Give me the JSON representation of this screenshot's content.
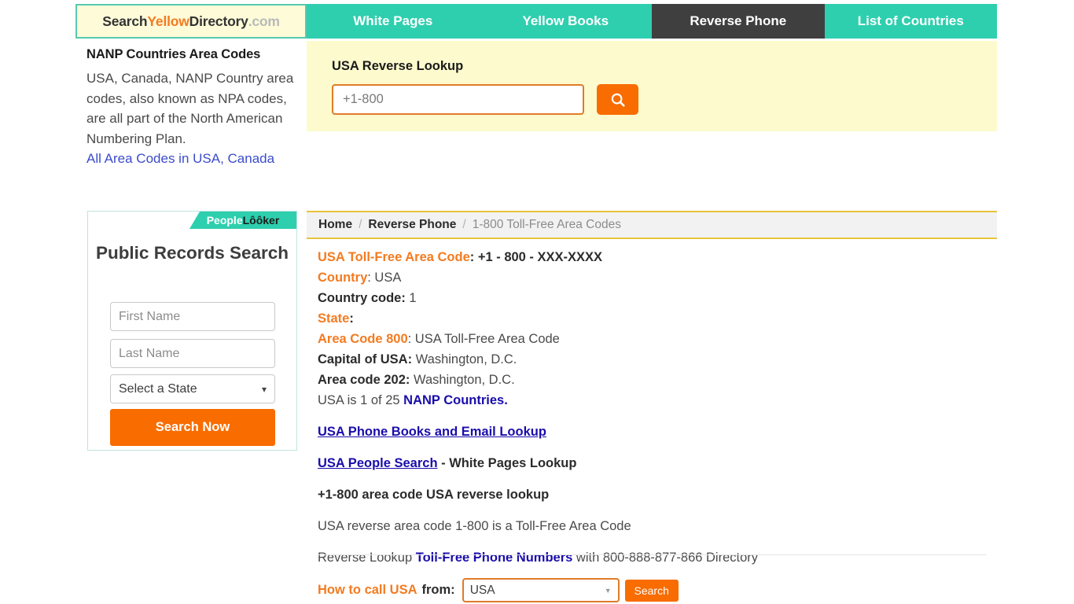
{
  "header": {
    "logo": {
      "search": "Search",
      "yellow": "Yellow",
      "directory": "Directory",
      "com": ".com"
    },
    "nav": [
      {
        "label": "White Pages",
        "active": false
      },
      {
        "label": "Yellow Books",
        "active": false
      },
      {
        "label": "Reverse Phone",
        "active": true
      },
      {
        "label": "List of Countries",
        "active": false
      }
    ]
  },
  "sidebar": {
    "title": "NANP Countries Area Codes",
    "body": "USA, Canada, NANP Country area codes, also known as NPA codes, are all part of the North American Numbering Plan.",
    "link": "All Area Codes in USA, Canada"
  },
  "search_panel": {
    "title": "USA Reverse Lookup",
    "input_placeholder": "+1-800",
    "input_value": "",
    "button_icon": "search-icon"
  },
  "people_looker": {
    "brand_people": "People",
    "brand_looker": "Lôôker",
    "title": "Public Records Search",
    "first_name_placeholder": "First Name",
    "last_name_placeholder": "Last Name",
    "state_selected": "Select a State",
    "state_chevron": "chevron-down-icon",
    "search_button": "Search Now"
  },
  "breadcrumb": {
    "home": "Home",
    "section": "Reverse Phone",
    "current": "1-800 Toll-Free Area Codes",
    "separator": "/"
  },
  "main": {
    "heading_label": "USA Toll-Free Area Code",
    "heading_value": ": +1 - 800 - XXX-XXXX",
    "country_label": "Country",
    "country_value": ": USA",
    "country_code_label": "Country code:",
    "country_code_value": " 1",
    "state_label": "State",
    "state_value": ":",
    "area_code_label": "Area Code 800",
    "area_code_value": ": USA Toll-Free Area Code",
    "capital_label": "Capital of USA:",
    "capital_value": " Washington, D.C.",
    "area_code_202_label": "Area code 202:",
    "area_code_202_value": " Washington, D.C.",
    "nanp_prefix": "USA is 1 of 25 ",
    "nanp_link": "NANP Countries.",
    "phone_books_link": "USA Phone Books and Email Lookup",
    "people_search_link": "USA People Search",
    "people_search_suffix": " - White Pages Lookup",
    "reverse_lookup_bold": "+1-800 area code USA reverse lookup",
    "reverse_area_text": "USA reverse area code 1-800 is a Toll-Free Area Code",
    "toll_free_prefix": "Reverse Lookup ",
    "toll_free_link": "Toll-Free Phone Numbers",
    "toll_free_suffix": " with 800-888-877-866 Directory"
  },
  "how_to_call": {
    "label": "How to call USA",
    "from": "from:",
    "country_selected": "USA",
    "dropdown_icon": "triangle-down-icon",
    "search_button": "Search"
  },
  "colors": {
    "teal": "#2ecfae",
    "orange": "#f86c00",
    "orange_text": "#f47b20",
    "blue_link": "#1a0dab",
    "active_tab": "#3f3f3f",
    "panel_yellow": "#fdfbcd",
    "gold_border": "#e8c339"
  }
}
